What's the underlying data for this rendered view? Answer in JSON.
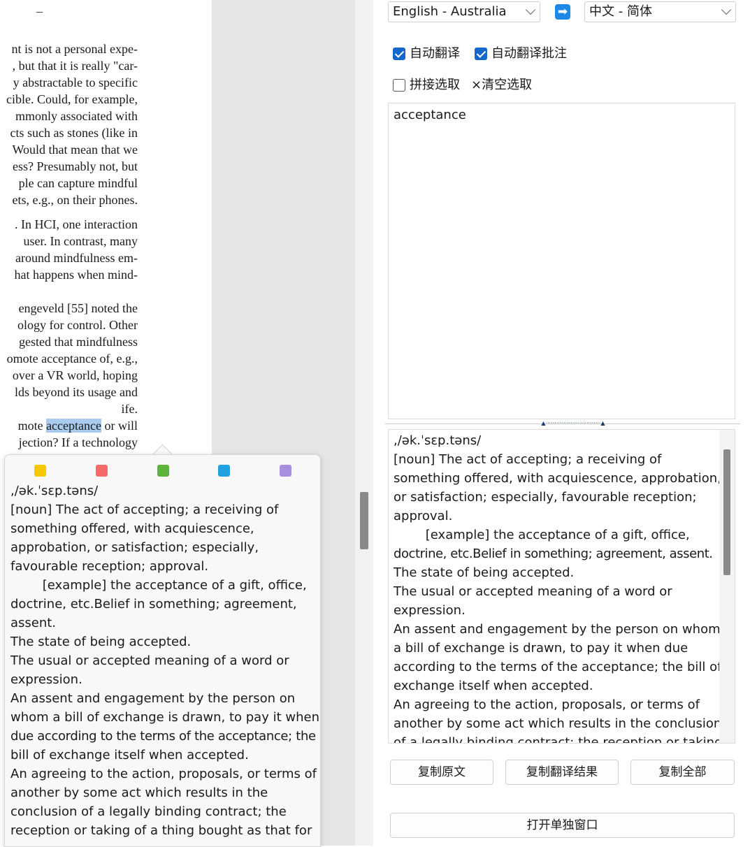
{
  "document": {
    "header_mark": "–",
    "lines": [
      {
        "text": "nt is not a personal expe-"
      },
      {
        "text": ", but that it is really \"car-"
      },
      {
        "text": "y abstractable to specific"
      },
      {
        "text": "cible. Could, for example,"
      },
      {
        "text": "mmonly associated with"
      },
      {
        "text": "cts such as stones (like in"
      },
      {
        "text": "Would that mean that we"
      },
      {
        "text": "ess? Presumably not, but"
      },
      {
        "text": "ple can capture mindful"
      },
      {
        "text": "ets, e.g., on their phones."
      },
      {
        "text": ". In HCI, one interaction"
      },
      {
        "text": "user. In contrast, many"
      },
      {
        "text": "around mindfulness em-"
      },
      {
        "text": "hat happens when mind-"
      },
      {
        "text": "engeveld [55] noted the"
      },
      {
        "text": "ology for control. Other"
      },
      {
        "text": "gested that mindfulness"
      },
      {
        "text": "omote acceptance of, e.g.,"
      },
      {
        "text": "over a VR world, hoping"
      },
      {
        "text": "lds beyond its usage and"
      },
      {
        "text": "ife."
      },
      {
        "text": "jection? If a technology"
      }
    ],
    "highlight_line": {
      "before": "mote ",
      "highlight": "acceptance",
      "after": " or will"
    }
  },
  "popup": {
    "swatches": [
      {
        "name": "yellow",
        "color": "#f5c800"
      },
      {
        "name": "red",
        "color": "#f56b6b"
      },
      {
        "name": "green",
        "color": "#5cb43c"
      },
      {
        "name": "blue",
        "color": "#21a1e0"
      },
      {
        "name": "purple",
        "color": "#a98ee0"
      }
    ],
    "lines": [
      ",/ək.ˈsɛp.təns/",
      "[noun] The act of accepting; a receiving of",
      "something offered, with acquiescence,",
      "approbation, or satisfaction; especially,",
      "favourable reception; approval.",
      "        [example] the acceptance of a gift, office,",
      "doctrine, etc.Belief in something; agreement,",
      "assent.",
      "The state of being accepted.",
      "The usual or accepted meaning of a word or",
      "expression.",
      "An assent and engagement by the person on",
      "whom a bill of exchange is drawn, to pay it when",
      "due according to the terms of the acceptance; the",
      "bill of exchange itself when accepted.",
      "An agreeing to the action, proposals, or terms of",
      "another by some act which results in the",
      "conclusion of a legally binding contract; the",
      "reception or taking of a thing bought as that for"
    ]
  },
  "translator": {
    "source_language": "English - Australia",
    "target_language": "中文 - 简体",
    "auto_translate": {
      "label": "自动翻译",
      "checked": true
    },
    "auto_translate_annotations": {
      "label": "自动翻译批注",
      "checked": true
    },
    "concat_selection": {
      "label": "拼接选取",
      "checked": false
    },
    "clear_selection": "×清空选取",
    "source_text": "acceptance",
    "result_lines": [
      ",/ək.ˈsɛp.təns/",
      "[noun] The act of accepting; a receiving of",
      "something offered, with acquiescence, approbation,",
      "or satisfaction; especially, favourable reception;",
      "approval.",
      "        [example] the acceptance of a gift, office,",
      "doctrine, etc.Belief in something; agreement, assent.",
      "The state of being accepted.",
      "The usual or accepted meaning of a word or",
      "expression.",
      "An assent and engagement by the person on whom",
      "a bill of exchange is drawn, to pay it when due",
      "according to the terms of the acceptance; the bill of",
      "exchange itself when accepted.",
      "An agreeing to the action, proposals, or terms of",
      "another by some act which results in the conclusion",
      "of a legally binding contract; the reception or taking"
    ],
    "buttons": {
      "copy_source": "复制原文",
      "copy_result": "复制翻译结果",
      "copy_all": "复制全部",
      "open_window": "打开单独窗口"
    },
    "colors": {
      "checkbox_accent": "#1567c9",
      "arrow_icon": "#1e88e5"
    }
  }
}
